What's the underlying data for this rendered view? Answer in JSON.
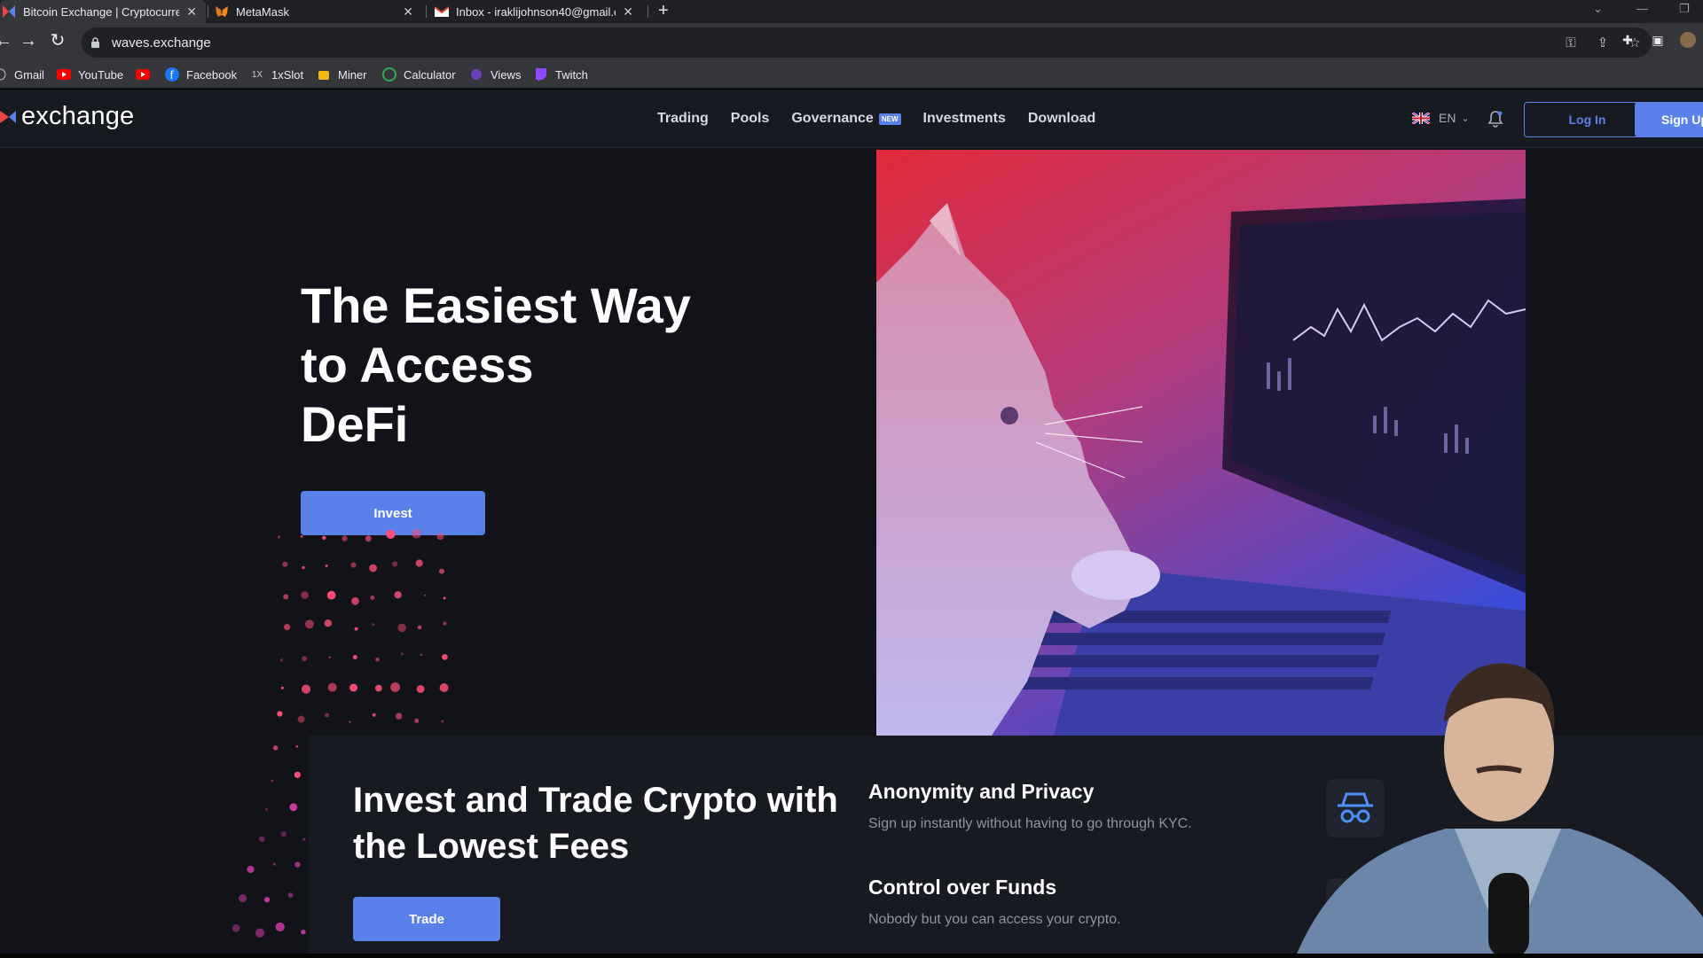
{
  "browser": {
    "tabs": [
      {
        "title": "Bitcoin Exchange | Cryptocurrenc",
        "active": true
      },
      {
        "title": "MetaMask",
        "active": false
      },
      {
        "title": "Inbox - iraklijohnson40@gmail.c",
        "active": false
      }
    ],
    "new_tab": "+",
    "url": "waves.exchange",
    "bookmarks": [
      "Gmail",
      "YouTube",
      "",
      "Facebook",
      "1xSlot",
      "Miner",
      "Calculator",
      "Views",
      "Twitch"
    ]
  },
  "site": {
    "logo_text": "exchange",
    "nav": [
      {
        "label": "Trading"
      },
      {
        "label": "Pools"
      },
      {
        "label": "Governance",
        "badge": "NEW"
      },
      {
        "label": "Investments"
      },
      {
        "label": "Download"
      }
    ],
    "language": "EN",
    "login_label": "Log In",
    "signup_label": "Sign Up",
    "hero": {
      "line1": "The Easiest Way",
      "line2": "to Access",
      "line3": "DeFi",
      "cta": "Invest"
    },
    "section2": {
      "title_line1": "Invest and Trade Crypto with",
      "title_line2_prefix": "the",
      "title_line2_bold": "Lowest Fees",
      "cta": "Trade"
    },
    "features": [
      {
        "title": "Anonymity and Privacy",
        "desc": "Sign up instantly without having to go through KYC."
      },
      {
        "title": "Control over Funds",
        "desc": "Nobody but you can access your crypto."
      }
    ]
  },
  "colors": {
    "accent": "#5a81ea",
    "background": "#121318",
    "header": "#181a22",
    "brand_red": "#ef4444"
  }
}
